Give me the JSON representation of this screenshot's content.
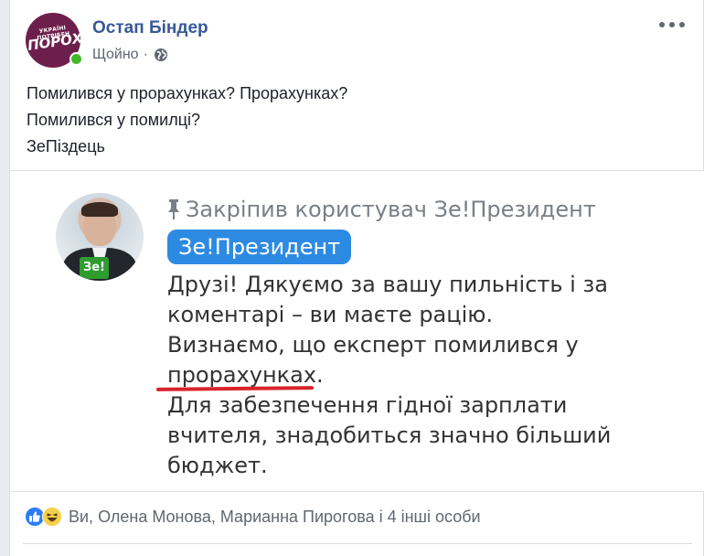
{
  "post": {
    "author": {
      "name": "Остап Біндер",
      "avatar_text_small": "УКРАЇНІ ПОТРІБЕН",
      "avatar_text_big": "ПОРОХ",
      "online": true
    },
    "timestamp": "Щойно",
    "separator": "·",
    "privacy_icon": "globe-icon",
    "more_icon": "more-options-icon",
    "text_lines": [
      "Помилився у прорахунках? Прорахунках?",
      "Помилився у помилці?",
      "ЗеПіздець"
    ]
  },
  "image": {
    "pinned_label": "Закріпив користувач Зе!Президент",
    "pinned_icon": "pin-icon",
    "admin_name": "Зе!Президент",
    "avatar_badge": "Зе!",
    "message_lines": [
      "Друзі! Дякуємо за вашу пильність і за",
      "коментарі – ви маєте рацію.",
      "Визнаємо, що експерт помилився у",
      "прорахунках.",
      "Для забезпечення гідної зарплати",
      "вчителя, знадобиться значно більший",
      "бюджет."
    ],
    "underline_color": "#d8232a"
  },
  "reactions": {
    "icons": [
      "like-icon",
      "haha-icon"
    ],
    "text": "Ви, Олена Монова, Марианна Пирогова і 4 інші особи"
  },
  "colors": {
    "link_blue": "#385898",
    "facebook_blue": "#2d8ae3",
    "online_green": "#42b72a",
    "avatar_purple": "#6d1f4b"
  }
}
